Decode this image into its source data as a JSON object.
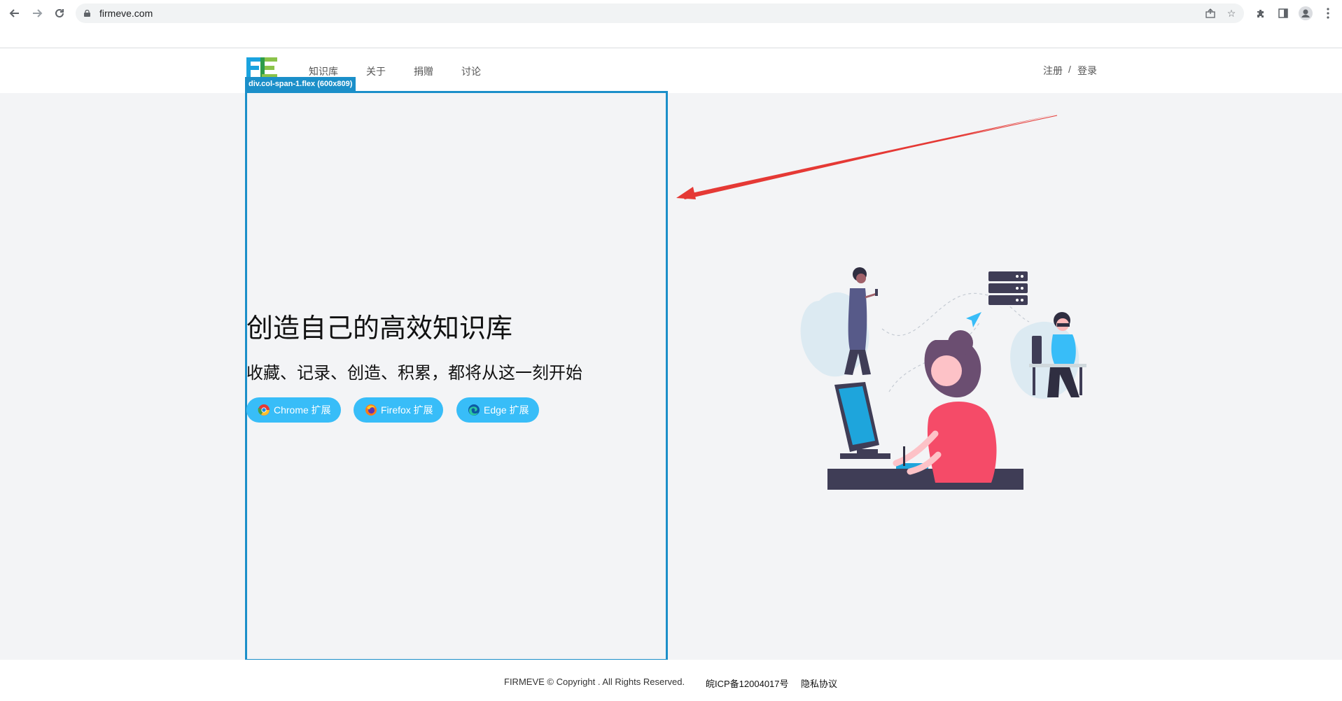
{
  "browser": {
    "url": "firmeve.com",
    "icons": [
      "back-icon",
      "forward-icon",
      "reload-icon",
      "lock-icon",
      "share-icon",
      "star-icon",
      "extensions-icon",
      "side-panel-icon",
      "profile-icon",
      "menu-icon"
    ]
  },
  "header": {
    "logo_text": "FE",
    "nav": [
      "知识库",
      "关于",
      "捐赠",
      "讨论"
    ],
    "register": "注册",
    "separator": "/",
    "login": "登录"
  },
  "debug": {
    "label": "div.col-span-1.flex (600x809)"
  },
  "hero": {
    "title": "创造自己的高效知识库",
    "subtitle": "收藏、记录、创造、积累，都将从这一刻开始",
    "buttons": [
      {
        "label": "Chrome 扩展",
        "icon": "chrome-icon"
      },
      {
        "label": "Firefox 扩展",
        "icon": "firefox-icon"
      },
      {
        "label": "Edge 扩展",
        "icon": "edge-icon"
      }
    ]
  },
  "footer": {
    "copyright": "FIRMEVE © Copyright . All Rights Reserved.",
    "icp": "皖ICP备12004017号",
    "privacy": "隐私协议"
  },
  "colors": {
    "accent": "#38bdf8",
    "debug_outline": "#1b8fc9",
    "arrow": "#e53935",
    "main_bg": "#f3f4f6"
  }
}
